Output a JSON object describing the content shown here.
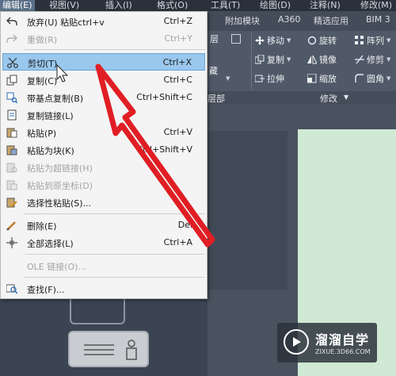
{
  "menubar": {
    "items": [
      "编辑(E)",
      "视图(V)",
      "插入(I)",
      "格式(O)",
      "工具(T)",
      "绘图(D)",
      "注释(N)",
      "修改(M)"
    ]
  },
  "ribbon": {
    "tabs": [
      "附加模块",
      "A360",
      "精选应用",
      "BIM 3"
    ],
    "left_label": "层",
    "clip_labels": [
      "藏",
      "层部"
    ],
    "buttons": [
      "移动",
      "旋转",
      "阵列",
      "复制",
      "镜像",
      "修剪",
      "拉伸",
      "缩放",
      "圆角"
    ],
    "panel_title": "修改"
  },
  "edit_menu": {
    "items": [
      {
        "icon": "undo-icon",
        "label": "放弃(U) 粘贴ctrl+v",
        "shortcut": "Ctrl+Z",
        "enabled": true,
        "highlighted": false
      },
      {
        "icon": "redo-icon",
        "label": "重做(R)",
        "shortcut": "Ctrl+Y",
        "enabled": false,
        "highlighted": false
      },
      {
        "icon": "scissors-icon",
        "label": "剪切(T)",
        "shortcut": "Ctrl+X",
        "enabled": true,
        "highlighted": true
      },
      {
        "icon": "copy-icon",
        "label": "复制(C)",
        "shortcut": "Ctrl+C",
        "enabled": true,
        "highlighted": false
      },
      {
        "icon": "copy-basepoint-icon",
        "label": "带基点复制(B)",
        "shortcut": "Ctrl+Shift+C",
        "enabled": true,
        "highlighted": false
      },
      {
        "icon": "copy-link-icon",
        "label": "复制链接(L)",
        "shortcut": "",
        "enabled": true,
        "highlighted": false
      },
      {
        "icon": "paste-icon",
        "label": "粘贴(P)",
        "shortcut": "Ctrl+V",
        "enabled": true,
        "highlighted": false
      },
      {
        "icon": "paste-block-icon",
        "label": "粘贴为块(K)",
        "shortcut": "Ctrl+Shift+V",
        "enabled": true,
        "highlighted": false
      },
      {
        "icon": "paste-hyperlink-icon",
        "label": "粘贴为超链接(H)",
        "shortcut": "",
        "enabled": false,
        "highlighted": false
      },
      {
        "icon": "paste-origin-icon",
        "label": "粘贴到原坐标(D)",
        "shortcut": "",
        "enabled": false,
        "highlighted": false
      },
      {
        "icon": "paste-special-icon",
        "label": "选择性粘贴(S)...",
        "shortcut": "",
        "enabled": true,
        "highlighted": false
      },
      {
        "icon": "erase-icon",
        "label": "删除(E)",
        "shortcut": "Del",
        "enabled": true,
        "highlighted": false
      },
      {
        "icon": "select-all-icon",
        "label": "全部选择(L)",
        "shortcut": "Ctrl+A",
        "enabled": true,
        "highlighted": false
      },
      {
        "icon": "",
        "label": "OLE 链接(O)...",
        "shortcut": "",
        "enabled": false,
        "highlighted": false
      },
      {
        "icon": "find-icon",
        "label": "查找(F)...",
        "shortcut": "",
        "enabled": true,
        "highlighted": false
      }
    ]
  },
  "watermark": {
    "title": "溜溜自学",
    "url": "ZIXUE.3D66.COM"
  },
  "colors": {
    "highlight": "#99c7ed",
    "arrow": "#e01e24",
    "canvas": "#cfe9d4"
  }
}
